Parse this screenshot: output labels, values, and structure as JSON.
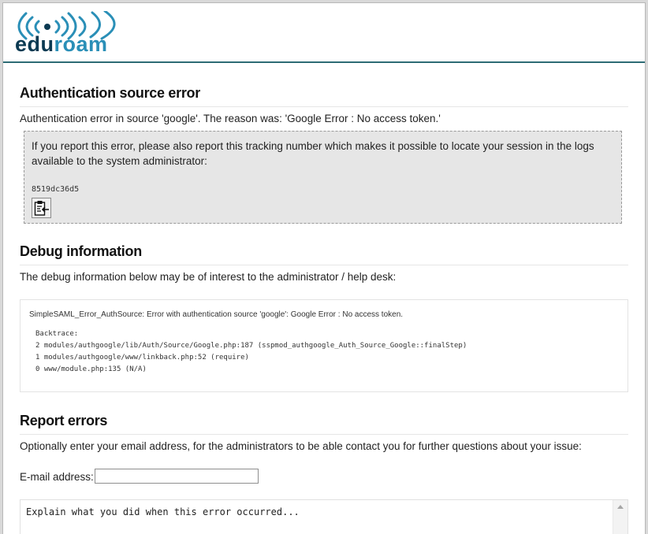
{
  "brand": {
    "name_part1": "edu",
    "name_part2": "roam",
    "colors": {
      "dark": "#0b3a52",
      "light": "#2a8fb7",
      "header_rule": "#2d6b75"
    }
  },
  "auth_error": {
    "heading": "Authentication source error",
    "message": "Authentication error in source 'google'. The reason was: 'Google Error : No access token.'",
    "tracking_text": "If you report this error, please also report this tracking number which makes it possible to locate your session in the logs available to the system administrator:",
    "tracking_number": "8519dc36d5",
    "copy_icon": "clipboard-copy-icon"
  },
  "debug": {
    "heading": "Debug information",
    "intro": "The debug information below may be of interest to the administrator / help desk:",
    "error_line": "SimpleSAML_Error_AuthSource: Error with authentication source 'google': Google Error : No access token.",
    "backtrace": "Backtrace:\n2 modules/authgoogle/lib/Auth/Source/Google.php:187 (sspmod_authgoogle_Auth_Source_Google::finalStep)\n1 modules/authgoogle/www/linkback.php:52 (require)\n0 www/module.php:135 (N/A)"
  },
  "report": {
    "heading": "Report errors",
    "intro": "Optionally enter your email address, for the administrators to be able contact you for further questions about your issue:",
    "email_label": "E-mail address:",
    "email_value": "",
    "textarea_placeholder": "Explain what you did when this error occurred..."
  }
}
